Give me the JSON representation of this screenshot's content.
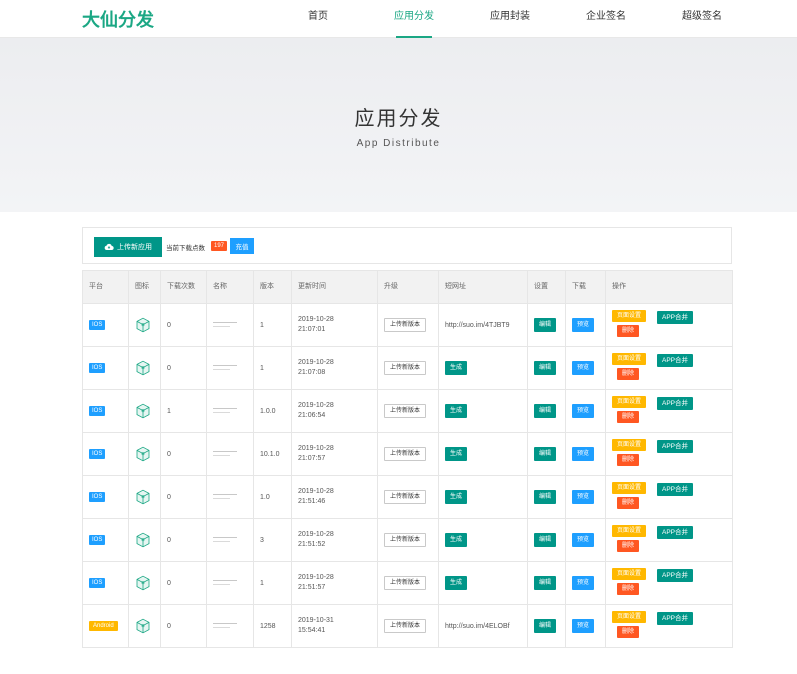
{
  "header": {
    "logo": "大仙分发",
    "nav": [
      "首页",
      "应用分发",
      "应用封装",
      "企业签名",
      "超级签名"
    ],
    "active_index": 1
  },
  "banner": {
    "title": "应用分发",
    "subtitle": "App Distribute"
  },
  "toolbar": {
    "upload_label": "上传新应用",
    "download_count_label": "当前下载点数",
    "download_count": "197",
    "recharge_label": "充值"
  },
  "table": {
    "headers": [
      "平台",
      "图标",
      "下载次数",
      "名称",
      "版本",
      "更新时间",
      "升级",
      "短网址",
      "设置",
      "下载",
      "操作"
    ],
    "rows": [
      {
        "platform": "IOS",
        "downloads": "0",
        "version": "1",
        "date": "2019-10-28",
        "time": "21:07:01",
        "upgrade": "上传新版本",
        "short_url": "http://suo.im/4TJBT9",
        "generate": "",
        "edit": "编辑",
        "preview": "预览",
        "page_settings": "页面设置",
        "delete": "删除",
        "merge": "APP合并"
      },
      {
        "platform": "IOS",
        "downloads": "0",
        "version": "1",
        "date": "2019-10-28",
        "time": "21:07:08",
        "upgrade": "上传新版本",
        "short_url": "",
        "generate": "生成",
        "edit": "编辑",
        "preview": "预览",
        "page_settings": "页面设置",
        "delete": "删除",
        "merge": "APP合并"
      },
      {
        "platform": "IOS",
        "downloads": "1",
        "version": "1.0.0",
        "date": "2019-10-28",
        "time": "21:06:54",
        "upgrade": "上传新版本",
        "short_url": "",
        "generate": "生成",
        "edit": "编辑",
        "preview": "预览",
        "page_settings": "页面设置",
        "delete": "删除",
        "merge": "APP合并"
      },
      {
        "platform": "IOS",
        "downloads": "0",
        "version": "10.1.0",
        "date": "2019-10-28",
        "time": "21:07:57",
        "upgrade": "上传新版本",
        "short_url": "",
        "generate": "生成",
        "edit": "编辑",
        "preview": "预览",
        "page_settings": "页面设置",
        "delete": "删除",
        "merge": "APP合并"
      },
      {
        "platform": "IOS",
        "downloads": "0",
        "version": "1.0",
        "date": "2019-10-28",
        "time": "21:51:46",
        "upgrade": "上传新版本",
        "short_url": "",
        "generate": "生成",
        "edit": "编辑",
        "preview": "预览",
        "page_settings": "页面设置",
        "delete": "删除",
        "merge": "APP合并"
      },
      {
        "platform": "IOS",
        "downloads": "0",
        "version": "3",
        "date": "2019-10-28",
        "time": "21:51:52",
        "upgrade": "上传新版本",
        "short_url": "",
        "generate": "生成",
        "edit": "编辑",
        "preview": "预览",
        "page_settings": "页面设置",
        "delete": "删除",
        "merge": "APP合并"
      },
      {
        "platform": "IOS",
        "downloads": "0",
        "version": "1",
        "date": "2019-10-28",
        "time": "21:51:57",
        "upgrade": "上传新版本",
        "short_url": "",
        "generate": "生成",
        "edit": "编辑",
        "preview": "预览",
        "page_settings": "页面设置",
        "delete": "删除",
        "merge": "APP合并"
      },
      {
        "platform": "Android",
        "downloads": "0",
        "version": "1258",
        "date": "2019-10-31",
        "time": "15:54:41",
        "upgrade": "上传新版本",
        "short_url": "http://suo.im/4ELOBf",
        "generate": "",
        "edit": "编辑",
        "preview": "预览",
        "page_settings": "页面设置",
        "delete": "删除",
        "merge": "APP合并"
      }
    ]
  },
  "colors": {
    "brand": "#1ba784",
    "primary": "#009688",
    "blue": "#1e9fff",
    "yellow": "#ffb800",
    "red": "#ff5722"
  }
}
